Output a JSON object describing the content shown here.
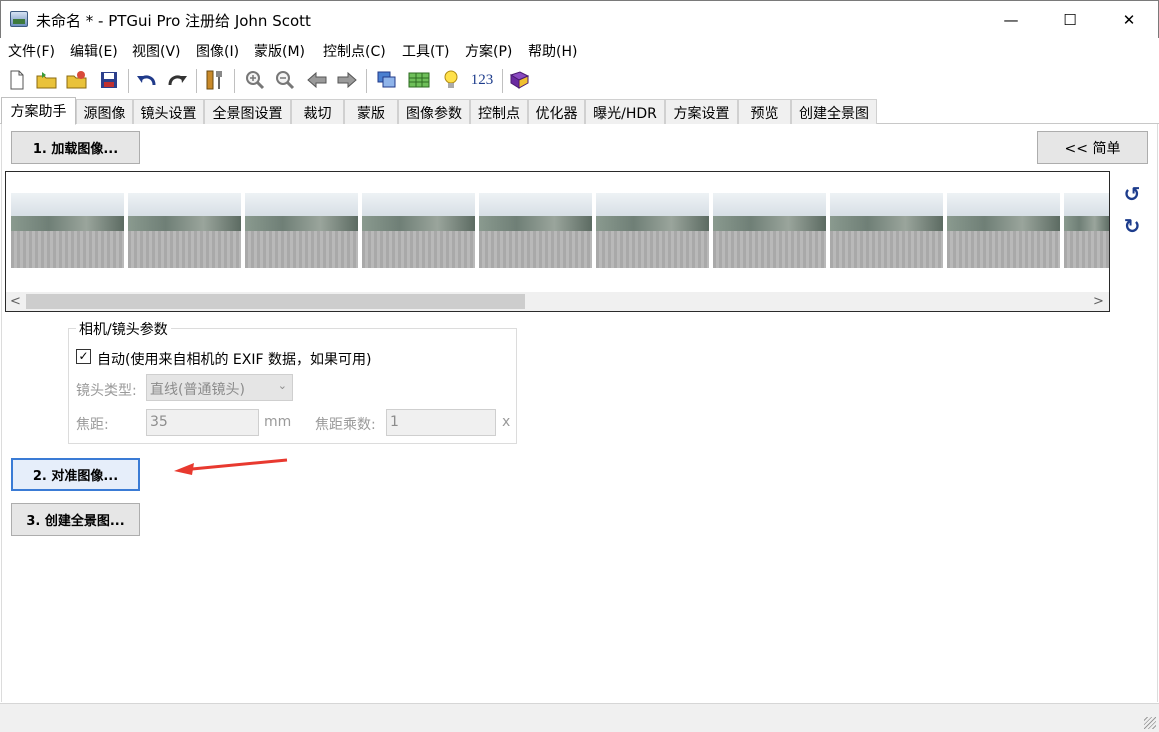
{
  "window": {
    "title": "未命名 * - PTGui Pro 注册给 John Scott",
    "minimize": "—",
    "maximize": "☐",
    "close": "✕"
  },
  "menu": [
    "文件(F)",
    "编辑(E)",
    "视图(V)",
    "图像(I)",
    "蒙版(M)",
    "控制点(C)",
    "工具(T)",
    "方案(P)",
    "帮助(H)"
  ],
  "toolbar": {
    "icons": [
      "new-file-icon",
      "open-folder-icon",
      "open-recent-icon",
      "save-icon",
      "undo-icon",
      "redo-icon",
      "tools-icon",
      "zoom-in-icon",
      "zoom-out-icon",
      "back-icon",
      "forward-icon",
      "panorama-editor-icon",
      "table-icon",
      "light-bulb-icon",
      "numbers-icon",
      "help-book-icon"
    ],
    "numbers_label": "123"
  },
  "tabs": [
    "方案助手",
    "源图像",
    "镜头设置",
    "全景图设置",
    "裁切",
    "蒙版",
    "图像参数",
    "控制点",
    "优化器",
    "曝光/HDR",
    "方案设置",
    "预览",
    "创建全景图"
  ],
  "active_tab": "方案助手",
  "buttons": {
    "load": "1. 加载图像...",
    "simple": "<< 简单",
    "align": "2. 对准图像...",
    "create": "3. 创建全景图..."
  },
  "thumbnails_count": 10,
  "camera_group": {
    "title": "相机/镜头参数",
    "auto_checked": true,
    "auto_label": "自动(使用来自相机的 EXIF 数据，如果可用)",
    "lens_type_label": "镜头类型:",
    "lens_type_value": "直线(普通镜头)",
    "focal_label": "焦距:",
    "focal_value": "35",
    "focal_unit": "mm",
    "multiplier_label": "焦距乘数:",
    "multiplier_value": "1",
    "multiplier_unit": "x"
  },
  "colors": {
    "arrow": "#e8392f",
    "focus": "#3a7bd5"
  }
}
